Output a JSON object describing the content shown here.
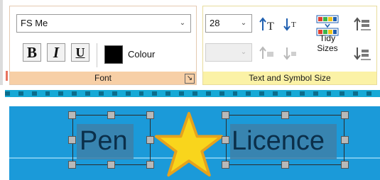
{
  "ribbon": {
    "font_group": {
      "font_name": "FS Me",
      "bold_label": "B",
      "italic_label": "I",
      "underline_label": "U",
      "colour_label": "Colour",
      "colour_value": "#000000",
      "footer": "Font",
      "launcher_icon": "dialog-launcher-icon"
    },
    "size_group": {
      "font_size": "28",
      "symbol_size": "",
      "tidy_label_line1": "Tidy",
      "tidy_label_line2": "Sizes",
      "footer": "Text and Symbol Size",
      "icons": [
        "increase-text-size-icon",
        "decrease-text-size-icon",
        "increase-symbol-size-icon",
        "decrease-symbol-size-icon",
        "tidy-sizes-icon",
        "increase-both-size-icon",
        "decrease-both-size-icon"
      ]
    }
  },
  "canvas": {
    "words": [
      "Pen",
      "Licence"
    ],
    "symbol": "star-icon",
    "colors": {
      "band": "#1b9ad9",
      "ruler": "#16a9d6",
      "star_fill": "#f9d51c",
      "star_outline": "#e6a21c"
    }
  }
}
